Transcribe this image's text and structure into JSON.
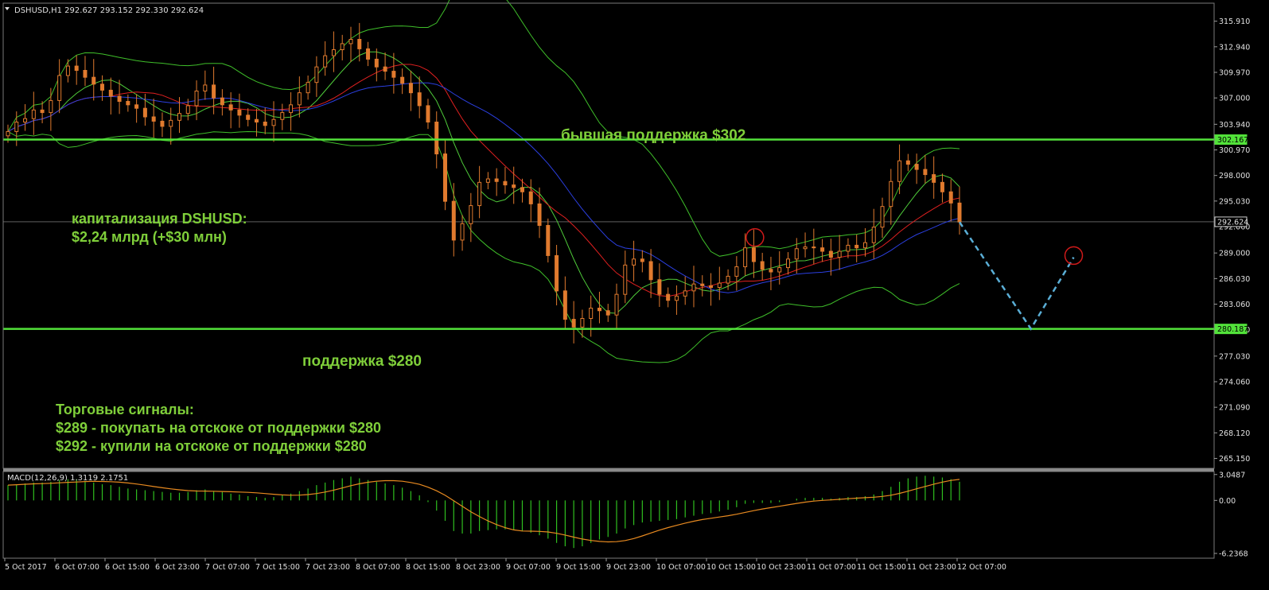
{
  "chart_data": {
    "type": "candlestick",
    "header": "DSHUSD,H1  292.627 293.152 292.330 292.624",
    "symbol": "DSHUSD",
    "timeframe": "H1",
    "ohlc": {
      "open": 292.627,
      "high": 293.152,
      "low": 292.33,
      "close": 292.624
    },
    "price_axis": {
      "range": [
        264.0,
        318.0
      ],
      "ticks": [
        "315.910",
        "312.940",
        "309.970",
        "307.000",
        "303.940",
        "300.970",
        "298.000",
        "295.030",
        "292.060",
        "289.000",
        "286.030",
        "283.060",
        "280.090",
        "277.030",
        "274.060",
        "271.090",
        "268.120",
        "265.150"
      ],
      "markers": [
        {
          "value": 302.167,
          "label": "302.167"
        },
        {
          "value": 292.624,
          "label": "292.624"
        },
        {
          "value": 280.187,
          "label": "280.187"
        }
      ]
    },
    "time_axis": [
      "5 Oct 2017",
      "6 Oct 07:00",
      "6 Oct 15:00",
      "6 Oct 23:00",
      "7 Oct 07:00",
      "7 Oct 15:00",
      "7 Oct 23:00",
      "8 Oct 07:00",
      "8 Oct 15:00",
      "8 Oct 23:00",
      "9 Oct 07:00",
      "9 Oct 15:00",
      "9 Oct 23:00",
      "10 Oct 07:00",
      "10 Oct 15:00",
      "10 Oct 23:00",
      "11 Oct 07:00",
      "11 Oct 15:00",
      "11 Oct 23:00",
      "12 Oct 07:00"
    ],
    "levels": [
      {
        "value": 302.167,
        "label": "бывшая поддержка $302"
      },
      {
        "value": 280.187,
        "label": "поддержка $280"
      }
    ],
    "macd": {
      "header": "MACD(12,26,9) 1.3119 2.1751",
      "ticks": [
        "3.0487",
        "0.00",
        "-6.2368"
      ],
      "range": [
        -6.8,
        3.4
      ]
    },
    "close_path": [
      303.1,
      304.2,
      304.6,
      305.6,
      305.3,
      306.7,
      309.6,
      310.7,
      310.2,
      309.4,
      308.6,
      307.9,
      307.2,
      306.6,
      306.2,
      305.8,
      304.8,
      304.3,
      303.7,
      304.4,
      305.2,
      306.1,
      307.8,
      308.5,
      307.0,
      306.2,
      305.6,
      305.0,
      304.5,
      304.2,
      303.8,
      304.5,
      305.3,
      306.2,
      307.6,
      308.8,
      310.6,
      311.9,
      312.6,
      313.3,
      313.8,
      312.7,
      311.5,
      310.6,
      310.1,
      309.4,
      308.7,
      307.6,
      306.1,
      304.2,
      300.5,
      295.0,
      290.5,
      292.4,
      294.5,
      297.2,
      297.6,
      297.3,
      296.9,
      296.6,
      296.1,
      294.7,
      292.2,
      288.7,
      284.6,
      281.3,
      280.4,
      281.4,
      282.6,
      282.3,
      281.8,
      284.2,
      287.6,
      288.3,
      288.0,
      285.9,
      284.2,
      283.5,
      284.0,
      284.6,
      285.4,
      285.2,
      285.0,
      285.5,
      286.3,
      287.4,
      289.6,
      288.0,
      287.1,
      286.8,
      287.3,
      288.3,
      289.5,
      289.7,
      289.6,
      289.2,
      288.5,
      289.2,
      289.9,
      289.6,
      290.2,
      292.0,
      294.4,
      297.3,
      299.7,
      299.3,
      298.7,
      298.1,
      297.2,
      296.1,
      294.8,
      292.6
    ],
    "macd_hist": [
      1.8,
      1.9,
      2.0,
      2.1,
      2.1,
      2.2,
      2.4,
      2.5,
      2.5,
      2.3,
      2.1,
      1.9,
      1.8,
      1.6,
      1.4,
      1.3,
      1.2,
      1.1,
      1.0,
      0.9,
      0.9,
      1.0,
      1.2,
      1.3,
      1.1,
      1.0,
      0.8,
      0.7,
      0.5,
      0.4,
      0.3,
      0.4,
      0.6,
      0.8,
      1.1,
      1.4,
      1.8,
      2.1,
      2.4,
      2.6,
      2.8,
      2.6,
      2.4,
      2.2,
      2.0,
      1.8,
      1.5,
      1.1,
      0.6,
      -0.2,
      -1.2,
      -2.4,
      -3.6,
      -3.9,
      -3.9,
      -3.6,
      -3.5,
      -3.4,
      -3.4,
      -3.5,
      -3.6,
      -3.8,
      -4.1,
      -4.5,
      -5.0,
      -5.4,
      -5.6,
      -5.4,
      -5.0,
      -4.6,
      -4.3,
      -3.9,
      -3.3,
      -2.9,
      -2.6,
      -2.5,
      -2.4,
      -2.3,
      -2.2,
      -2.0,
      -1.8,
      -1.6,
      -1.5,
      -1.3,
      -1.1,
      -0.8,
      -0.4,
      -0.3,
      -0.3,
      -0.3,
      -0.2,
      0.0,
      0.2,
      0.3,
      0.3,
      0.3,
      0.2,
      0.3,
      0.4,
      0.4,
      0.5,
      0.7,
      1.1,
      1.6,
      2.2,
      2.6,
      2.8,
      2.9,
      2.8,
      2.7,
      2.5,
      2.2
    ],
    "projection": [
      {
        "time_index": 1.0,
        "price": 292.6
      },
      {
        "time_index": 1.075,
        "price": 280.2
      },
      {
        "time_index": 1.12,
        "price": 288.5
      }
    ],
    "circles": [
      {
        "time_index": 0.785,
        "price": 290.8
      },
      {
        "time_index": 1.12,
        "price": 288.7
      }
    ],
    "colors": {
      "background": "#000000",
      "candle": "#e07a2e",
      "level": "#52e23a",
      "bollinger": "#3fbf2a",
      "ma_fast": "#4fcc3a",
      "ma_mid": "#e02020",
      "ma_slow": "#2b3fe0",
      "macd_hist": "#2fbf1f",
      "macd_signal": "#e88a20",
      "projection": "#5aaed6",
      "circle": "#d01a1a",
      "annotation": "#7fcf3a"
    }
  },
  "annotations": {
    "cap_line1": "капитализация DSHUSD:",
    "cap_line2": "$2,24 млрд (+$30 млн)",
    "signals_title": "Торговые сигналы:",
    "signal_1": "$289 - покупать на отскоке от поддержки $280",
    "signal_2": "$292 - купили на отскоке от поддержки $280"
  }
}
